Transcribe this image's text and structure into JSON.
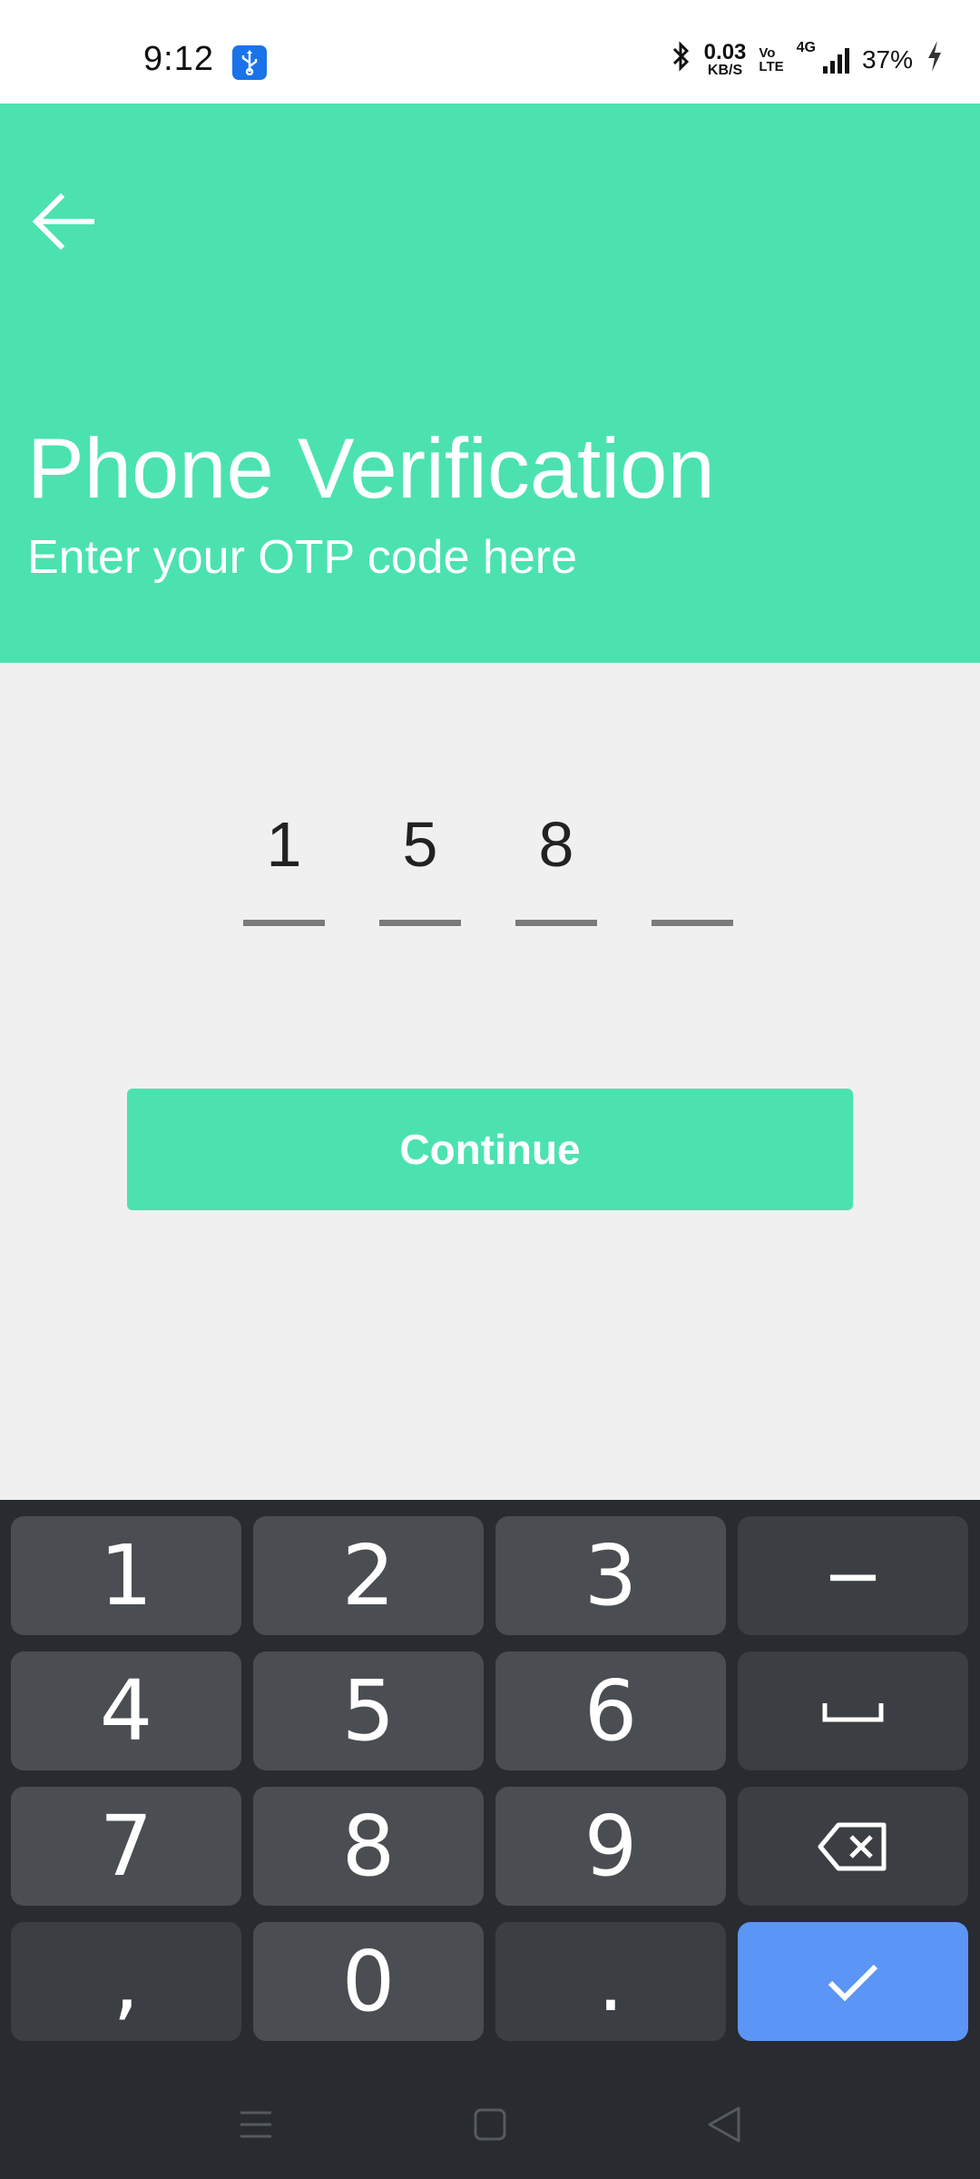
{
  "status_bar": {
    "time": "9:12",
    "net_speed_value": "0.03",
    "net_speed_unit": "KB/S",
    "volte_top": "Vo",
    "volte_bottom": "LTE",
    "network_type": "4G",
    "battery": "37%",
    "icons": [
      "usb-icon",
      "bluetooth-icon",
      "signal-icon",
      "charging-icon"
    ]
  },
  "header": {
    "title": "Phone Verification",
    "subtitle": "Enter your OTP code here",
    "background_color": "#4be2b0"
  },
  "otp": {
    "digits": [
      "1",
      "5",
      "8",
      ""
    ]
  },
  "continue_button": {
    "label": "Continue"
  },
  "keyboard": {
    "keys": [
      {
        "label": "1"
      },
      {
        "label": "2"
      },
      {
        "label": "3"
      },
      {
        "label": "−"
      },
      {
        "label": "4"
      },
      {
        "label": "5"
      },
      {
        "label": "6"
      },
      {
        "label": "space-icon"
      },
      {
        "label": "7"
      },
      {
        "label": "8"
      },
      {
        "label": "9"
      },
      {
        "label": "backspace-icon"
      },
      {
        "label": ","
      },
      {
        "label": "0"
      },
      {
        "label": "."
      },
      {
        "label": "check-icon"
      }
    ],
    "enter_color": "#5b95f5"
  },
  "nav_bar": {
    "icons": [
      "menu-icon",
      "home-icon",
      "back-icon"
    ]
  }
}
